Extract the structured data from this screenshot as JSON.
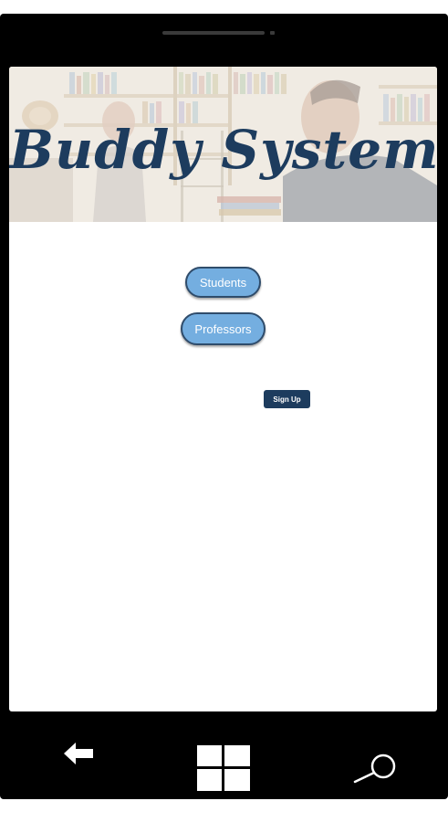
{
  "banner": {
    "title": "Buddy System"
  },
  "main": {
    "students_label": "Students",
    "professors_label": "Professors",
    "signup_label": "Sign Up"
  },
  "nav": {
    "back_icon": "back-arrow-icon",
    "home_icon": "windows-start-icon",
    "search_icon": "search-icon"
  },
  "colors": {
    "accent_blue": "#74aee0",
    "brand_navy": "#1d3c5e",
    "frame_black": "#000000"
  }
}
